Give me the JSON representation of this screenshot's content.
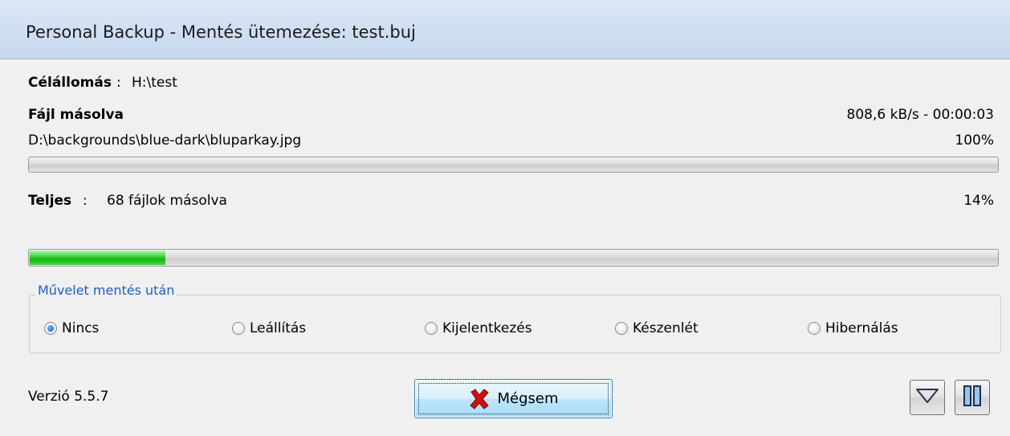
{
  "window": {
    "title": "Personal Backup - Mentés ütemezése: test.buj"
  },
  "destination": {
    "label": "Célállomás",
    "separator": ":",
    "value": "H:\\test"
  },
  "file": {
    "status": "Fájl másolva",
    "rate": "808,6 kB/s - 00:00:03",
    "path": "D:\\backgrounds\\blue-dark\\bluparkay.jpg",
    "percent": "100%",
    "progress": 1.0
  },
  "total": {
    "label": "Teljes",
    "separator": ":",
    "value": "68 fájlok másolva",
    "percent": "14%",
    "progress": 0.14
  },
  "after_action": {
    "legend": "Művelet mentés után",
    "options": [
      {
        "label": "Nincs",
        "checked": true
      },
      {
        "label": "Leállítás",
        "checked": false
      },
      {
        "label": "Kijelentkezés",
        "checked": false
      },
      {
        "label": "Készenlét",
        "checked": false
      },
      {
        "label": "Hibernálás",
        "checked": false
      }
    ]
  },
  "footer": {
    "version": "Verzió 5.5.7",
    "cancel_label": "Mégsem",
    "cancel_icon": "red-x-icon",
    "expand_icon": "triangle-down-icon",
    "pause_icon": "pause-icon"
  },
  "colors": {
    "progress_green": "#22c022",
    "group_legend": "#1d5fc4",
    "cancel_x": "#d01010"
  }
}
